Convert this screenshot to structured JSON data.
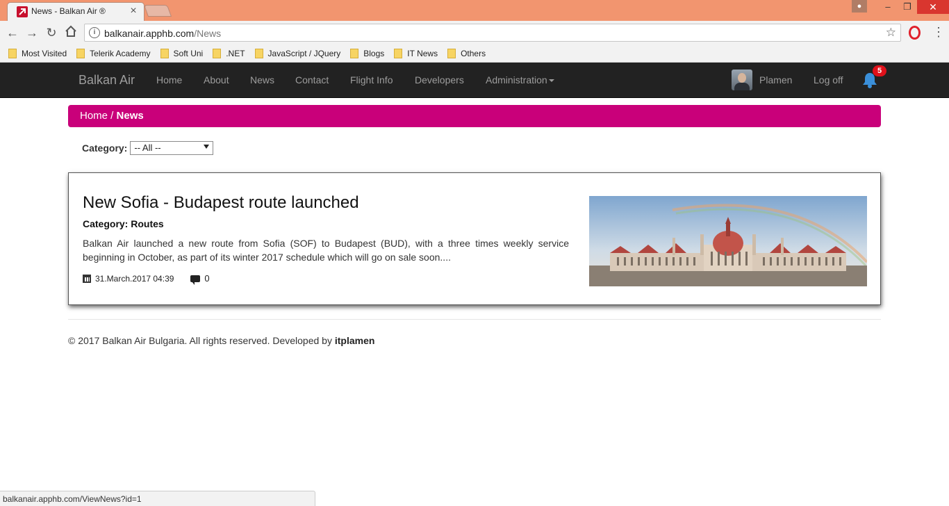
{
  "browser": {
    "tab_title": "News - Balkan Air ®",
    "tab_close": "×",
    "url_host": "balkanair.apphb.com",
    "url_path": "/News",
    "bookmarks": [
      "Most Visited",
      "Telerik Academy",
      "Soft Uni",
      ".NET",
      "JavaScript / JQuery",
      "Blogs",
      "IT News",
      "Others"
    ],
    "status_url": "balkanair.apphb.com/ViewNews?id=1"
  },
  "navbar": {
    "brand": "Balkan Air",
    "links": [
      "Home",
      "About",
      "News",
      "Contact",
      "Flight Info",
      "Developers",
      "Administration"
    ],
    "user": "Plamen",
    "logoff": "Log off",
    "notifications": "5"
  },
  "breadcrumb": {
    "home": "Home",
    "separator": " / ",
    "current": "News"
  },
  "filter": {
    "label": "Category:",
    "selected": "-- All --"
  },
  "news": [
    {
      "title": "New Sofia - Budapest route launched",
      "category_label": "Category:",
      "category": "Routes",
      "summary": "Balkan Air launched a new route from Sofia (SOF) to Budapest (BUD), with a three times weekly service beginning in October, as part of its winter 2017 schedule which will go on sale soon....",
      "date": "31.March.2017 04:39",
      "comments": "0"
    }
  ],
  "footer": {
    "text": "© 2017 Balkan Air Bulgaria. All rights reserved. Developed by ",
    "author": "itplamen"
  },
  "colors": {
    "accent": "#c9007a",
    "navbar": "#222222",
    "chrome_titlebar": "#f2956f"
  }
}
